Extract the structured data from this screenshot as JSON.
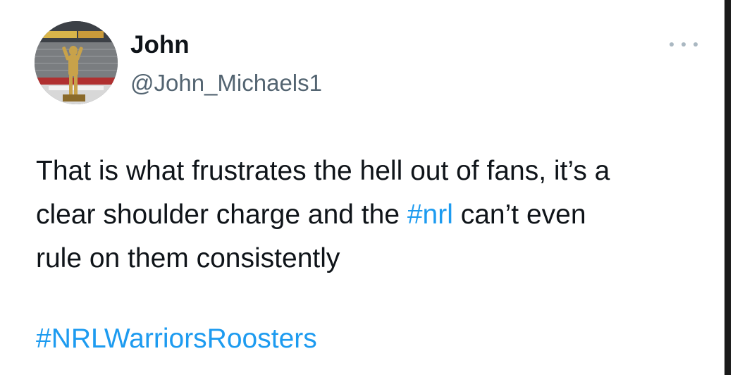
{
  "tweet": {
    "avatar_icon": "profile-photo-stadium-statue",
    "display_name": "John",
    "handle": "@John_Michaels1",
    "more_icon": "more-options-icon",
    "text": {
      "line1": "That is what frustrates the hell out of fans, it’s a",
      "line2_before": "clear shoulder charge and the ",
      "line2_hashtag": "#nrl",
      "line2_after": " can’t even",
      "line3": "rule on them consistently"
    },
    "footer_hashtag": "#NRLWarriorsRoosters"
  },
  "colors": {
    "text": "#0f1419",
    "secondary": "#536471",
    "link": "#1d9bf0"
  }
}
